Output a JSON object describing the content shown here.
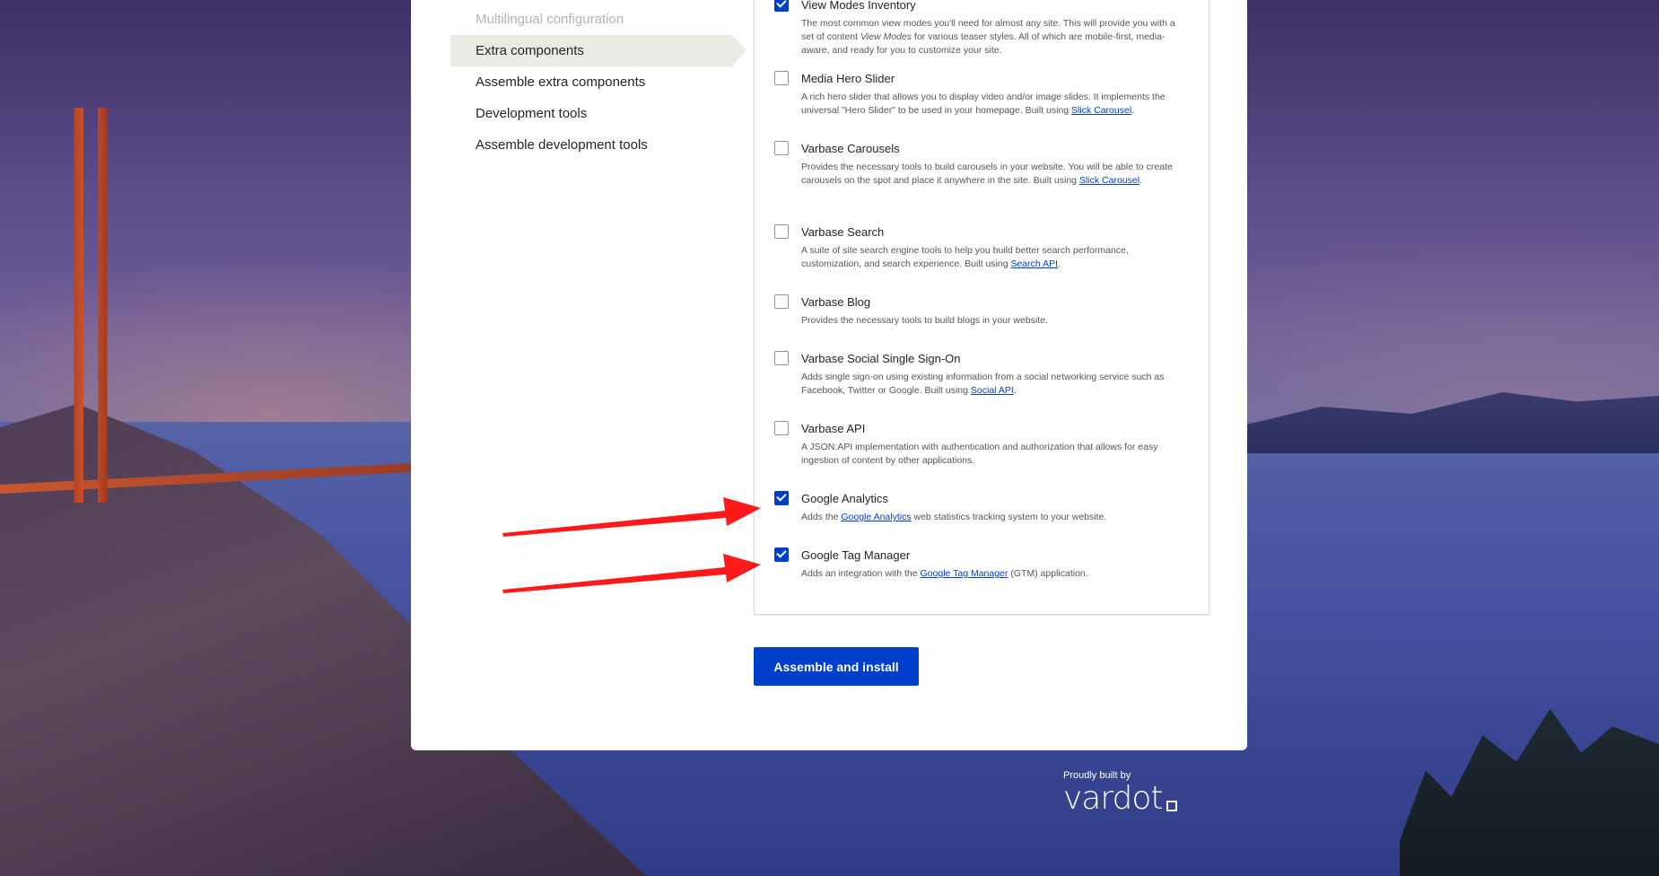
{
  "steps": [
    {
      "label": "Multilingual configuration",
      "state": "muted"
    },
    {
      "label": "Extra components",
      "state": "active"
    },
    {
      "label": "Assemble extra components",
      "state": "normal"
    },
    {
      "label": "Development tools",
      "state": "normal"
    },
    {
      "label": "Assemble development tools",
      "state": "normal"
    }
  ],
  "components": [
    {
      "label": "View Modes Inventory",
      "checked": true,
      "desc_parts": [
        "The most common view modes you'll need for almost any site. This will provide you with a set of content ",
        {
          "em": "View Modes"
        },
        " for various teaser styles. All of which are mobile-first, media-aware, and ready for you to customize your site."
      ]
    },
    {
      "label": "Media Hero Slider",
      "checked": false,
      "desc_parts": [
        "A rich hero slider that allows you to display video and/or image slides. It implements the universal \"Hero Slider\" to be used in your homepage. Built using ",
        {
          "link": "Slick Carousel"
        },
        "."
      ]
    },
    {
      "label": "Varbase Carousels",
      "checked": false,
      "desc_parts": [
        "Provides the necessary tools to build carousels in your website. You will be able to create carousels on the spot and place it anywhere in the site. Built using ",
        {
          "link": "Slick Carousel"
        },
        "."
      ]
    },
    {
      "label": "Varbase Search",
      "checked": false,
      "desc_parts": [
        "A suite of site search engine tools to help you build better search performance, customization, and search experience. Built using ",
        {
          "link": "Search API"
        },
        "."
      ]
    },
    {
      "label": "Varbase Blog",
      "checked": false,
      "desc_parts": [
        "Provides the necessary tools to build blogs in your website."
      ]
    },
    {
      "label": "Varbase Social Single Sign-On",
      "checked": false,
      "desc_parts": [
        "Adds single sign-on using existing information from a social networking service such as Facebook, Twitter or Google. Built using ",
        {
          "link": "Social API"
        },
        "."
      ]
    },
    {
      "label": "Varbase API",
      "checked": false,
      "desc_parts": [
        "A JSON:API implementation with authentication and authorization that allows for easy ingestion of content by other applications."
      ]
    },
    {
      "label": "Google Analytics",
      "checked": true,
      "desc_parts": [
        "Adds the ",
        {
          "link": "Google Analytics"
        },
        " web statistics tracking system to your website."
      ]
    },
    {
      "label": "Google Tag Manager",
      "checked": true,
      "desc_parts": [
        "Adds an integration with the ",
        {
          "link": "Google Tag Manager"
        },
        " (GTM) application."
      ]
    }
  ],
  "submit": {
    "label": "Assemble and install"
  },
  "footer": {
    "built_by": "Proudly built by",
    "brand": "vardot"
  },
  "colors": {
    "accent": "#003ecc",
    "annotation_arrow": "#ff1a1a",
    "active_step_bg": "#ebeae5"
  }
}
